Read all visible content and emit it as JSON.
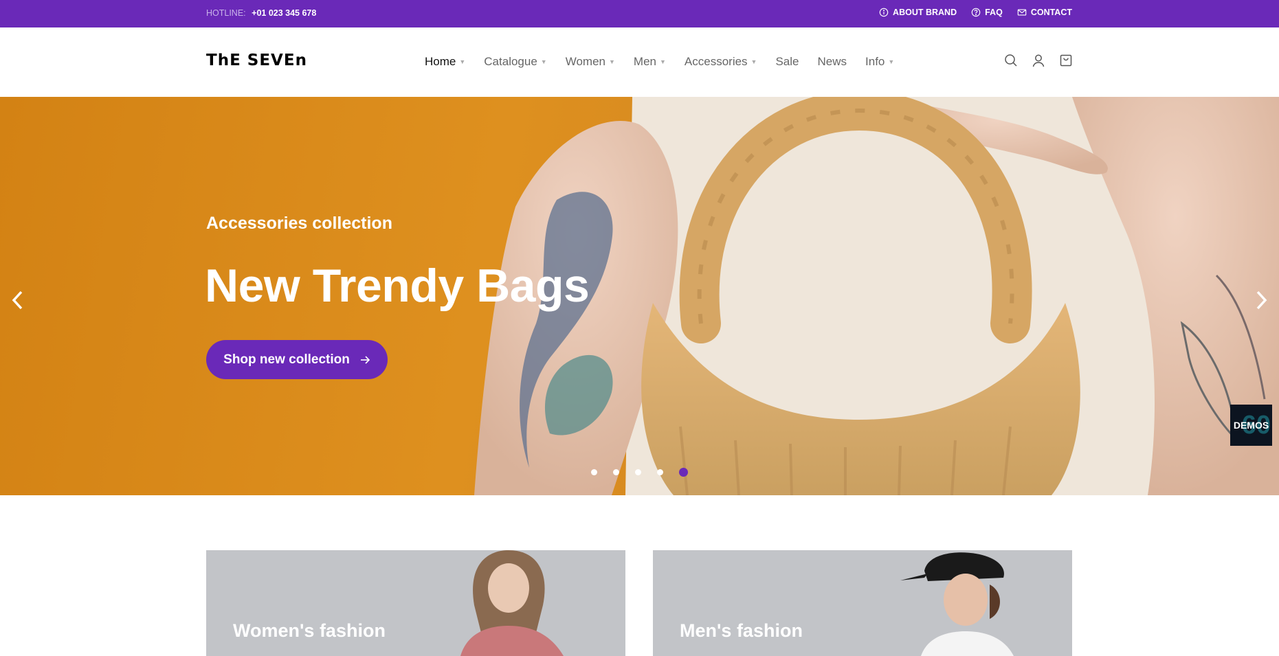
{
  "topbar": {
    "hotline_label": "HOTLINE:",
    "hotline_number": "+01 023 345 678",
    "links": [
      {
        "label": "ABOUT BRAND",
        "icon": "info-icon"
      },
      {
        "label": "FAQ",
        "icon": "help-icon"
      },
      {
        "label": "CONTACT",
        "icon": "mail-icon"
      }
    ]
  },
  "header": {
    "logo": "ThE SEVEn",
    "nav": [
      {
        "label": "Home",
        "dropdown": true,
        "active": true
      },
      {
        "label": "Catalogue",
        "dropdown": true
      },
      {
        "label": "Women",
        "dropdown": true
      },
      {
        "label": "Men",
        "dropdown": true
      },
      {
        "label": "Accessories",
        "dropdown": true
      },
      {
        "label": "Sale",
        "dropdown": false
      },
      {
        "label": "News",
        "dropdown": false
      },
      {
        "label": "Info",
        "dropdown": true
      }
    ],
    "icons": [
      "search-icon",
      "user-icon",
      "cart-icon"
    ]
  },
  "hero": {
    "subtitle": "Accessories collection",
    "title": "New Trendy Bags",
    "cta_label": "Shop new collection",
    "slides_total": 5,
    "active_slide": 5,
    "demos_label": "DEMOS"
  },
  "categories": [
    {
      "label": "Women's fashion"
    },
    {
      "label": "Men's fashion"
    }
  ],
  "colors": {
    "brand": "#6a29b8",
    "hero_bg": "#de901f"
  }
}
